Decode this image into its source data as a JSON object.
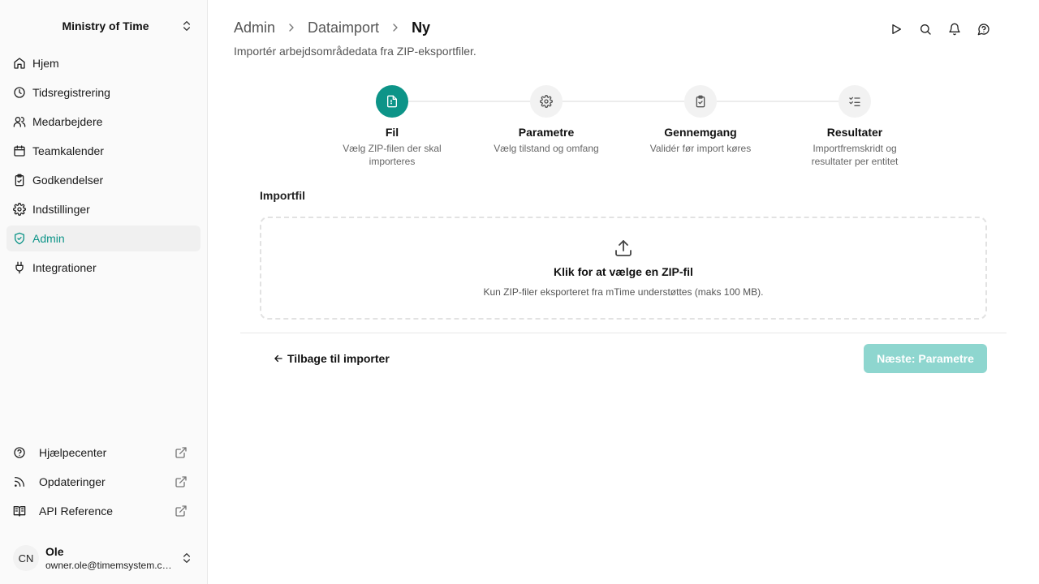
{
  "sidebar": {
    "workspace": "Ministry of Time",
    "items": [
      {
        "label": "Hjem",
        "icon": "home-icon"
      },
      {
        "label": "Tidsregistrering",
        "icon": "clock-icon"
      },
      {
        "label": "Medarbejdere",
        "icon": "users-icon"
      },
      {
        "label": "Teamkalender",
        "icon": "calendar-icon"
      },
      {
        "label": "Godkendelser",
        "icon": "clipboard-check-icon"
      },
      {
        "label": "Indstillinger",
        "icon": "gear-icon"
      },
      {
        "label": "Admin",
        "icon": "shield-check-icon",
        "active": true
      },
      {
        "label": "Integrationer",
        "icon": "plug-icon"
      }
    ],
    "bottom_items": [
      {
        "label": "Hjælpecenter",
        "icon": "help-circle-icon"
      },
      {
        "label": "Opdateringer",
        "icon": "rss-icon"
      },
      {
        "label": "API Reference",
        "icon": "book-icon"
      }
    ],
    "user": {
      "initials": "CN",
      "name": "Ole",
      "email": "owner.ole@timemsystem.com"
    }
  },
  "header": {
    "breadcrumb": [
      "Admin",
      "Dataimport",
      "Ny"
    ],
    "subtitle": "Importér arbejdsområdedata fra ZIP-eksportfiler."
  },
  "stepper": {
    "steps": [
      {
        "title": "Fil",
        "desc": "Vælg ZIP-filen der skal importeres",
        "active": true
      },
      {
        "title": "Parametre",
        "desc": "Vælg tilstand og omfang"
      },
      {
        "title": "Gennemgang",
        "desc": "Validér før import køres"
      },
      {
        "title": "Resultater",
        "desc": "Importfremskridt og resultater per entitet"
      }
    ]
  },
  "import": {
    "label": "Importfil",
    "drop_title": "Klik for at vælge en ZIP-fil",
    "drop_hint": "Kun ZIP-filer eksporteret fra mTime understøttes (maks 100 MB)."
  },
  "footer": {
    "back_label": "Tilbage til importer",
    "next_label": "Næste: Parametre"
  },
  "colors": {
    "accent": "#0d9488",
    "accent_disabled": "#8ed6cf"
  }
}
